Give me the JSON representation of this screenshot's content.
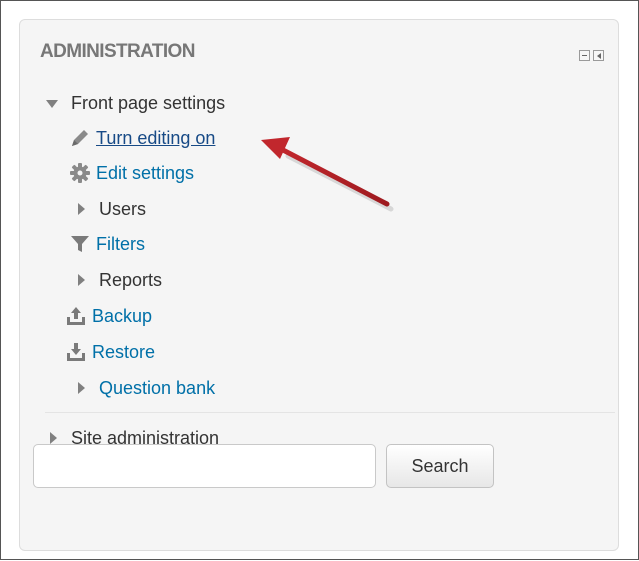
{
  "block": {
    "title": "ADMINISTRATION",
    "controls": [
      {
        "icon": "minimize-icon"
      },
      {
        "icon": "dock-icon"
      }
    ]
  },
  "menu": {
    "front_page": "Front page settings",
    "turn_editing": "Turn editing on",
    "edit_settings": "Edit settings",
    "users": "Users",
    "filters": "Filters",
    "reports": "Reports",
    "backup": "Backup",
    "restore": "Restore",
    "question_bank": "Question bank",
    "site_admin": "Site administration"
  },
  "search": {
    "value": "",
    "placeholder": "",
    "button": "Search"
  },
  "colors": {
    "link": "#0070a8",
    "arrow": "#c1272d",
    "text": "#333333"
  }
}
